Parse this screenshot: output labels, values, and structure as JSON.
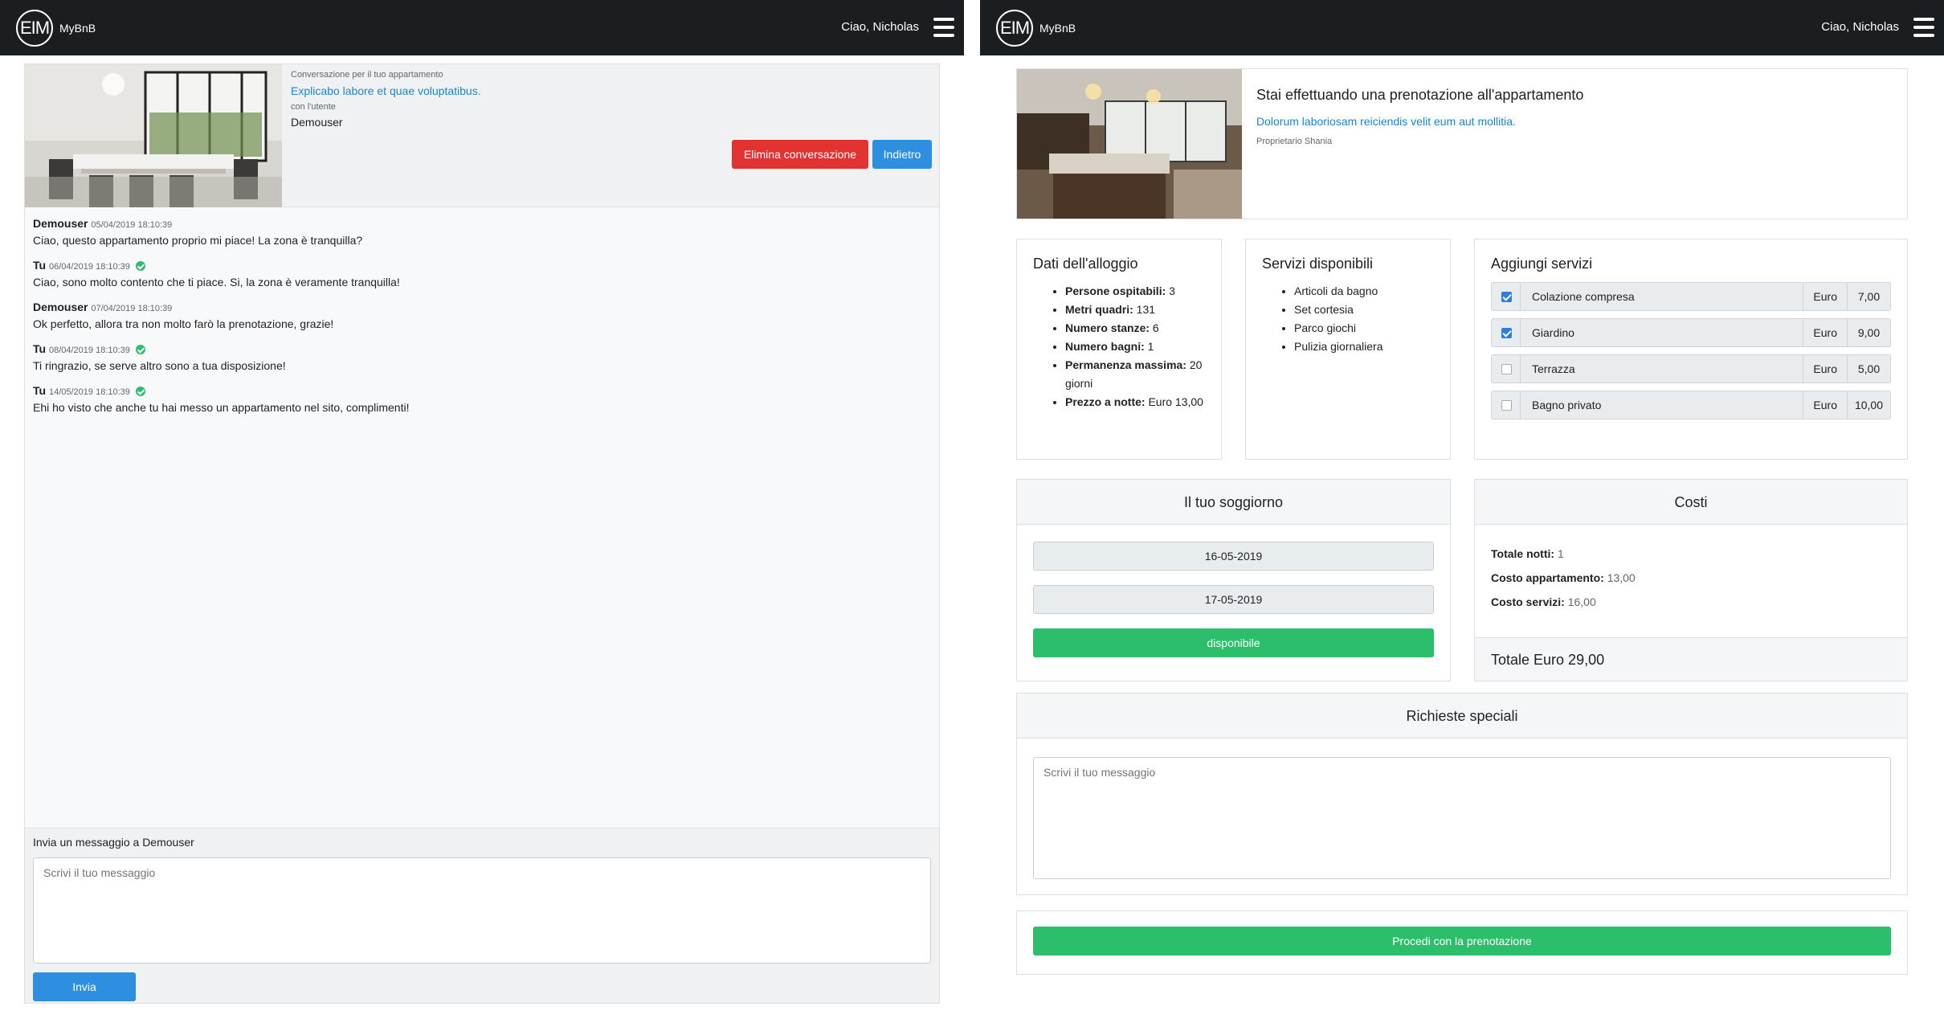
{
  "navbar": {
    "logo": "EIM",
    "brand": "MyBnB",
    "greeting": "Ciao, Nicholas"
  },
  "conversation": {
    "header_caption": "Conversazione per il tuo appartamento",
    "apartment_link": "Explicabo labore et quae voluptatibus.",
    "user_caption": "con l'utente",
    "user": "Demouser",
    "delete_button": "Elimina conversazione",
    "back_button": "Indietro",
    "messages": [
      {
        "author": "Demouser",
        "time": "05/04/2019 18:10:39",
        "text": "Ciao, questo appartamento proprio mi piace! La zona è tranquilla?",
        "mine": false
      },
      {
        "author": "Tu",
        "time": "06/04/2019 18:10:39",
        "text": "Ciao, sono molto contento che ti piace. Si, la zona è veramente tranquilla!",
        "mine": true
      },
      {
        "author": "Demouser",
        "time": "07/04/2019 18:10:39",
        "text": "Ok perfetto, allora tra non molto farò la prenotazione, grazie!",
        "mine": false
      },
      {
        "author": "Tu",
        "time": "08/04/2019 18:10:39",
        "text": "Ti ringrazio, se serve altro sono a tua disposizione!",
        "mine": true
      },
      {
        "author": "Tu",
        "time": "14/05/2019 18:10:39",
        "text": "Ehi ho visto che anche tu hai messo un appartamento nel sito, complimenti!",
        "mine": true
      }
    ],
    "compose_label": "Invia un messaggio a Demouser",
    "compose_placeholder": "Scrivi il tuo messaggio",
    "send_button": "Invia"
  },
  "booking": {
    "title": "Stai effettuando una prenotazione all'appartamento",
    "apartment_link": "Dolorum laboriosam reiciendis velit eum aut mollitia.",
    "owner": "Proprietario Shania",
    "info_title": "Dati dell'alloggio",
    "info": [
      {
        "label": "Persone ospitabili:",
        "value": "3"
      },
      {
        "label": "Metri quadri:",
        "value": "131"
      },
      {
        "label": "Numero stanze:",
        "value": "6"
      },
      {
        "label": "Numero bagni:",
        "value": "1"
      },
      {
        "label": "Permanenza massima:",
        "value": "20 giorni"
      },
      {
        "label": "Prezzo a notte:",
        "value": "Euro 13,00"
      }
    ],
    "services_title": "Servizi disponibili",
    "services": [
      "Articoli da bagno",
      "Set cortesia",
      "Parco giochi",
      "Pulizia giornaliera"
    ],
    "add_title": "Aggiungi servizi",
    "add_services": [
      {
        "name": "Colazione compresa",
        "currency": "Euro",
        "price": "7,00",
        "checked": true
      },
      {
        "name": "Giardino",
        "currency": "Euro",
        "price": "9,00",
        "checked": true
      },
      {
        "name": "Terrazza",
        "currency": "Euro",
        "price": "5,00",
        "checked": false
      },
      {
        "name": "Bagno privato",
        "currency": "Euro",
        "price": "10,00",
        "checked": false
      }
    ],
    "stay_title": "Il tuo soggiorno",
    "date_from": "16-05-2019",
    "date_to": "17-05-2019",
    "availability": "disponibile",
    "costs_title": "Costi",
    "nights_label": "Totale notti:",
    "nights_value": "1",
    "apt_cost_label": "Costo appartamento:",
    "apt_cost_value": "13,00",
    "services_cost_label": "Costo servizi:",
    "services_cost_value": "16,00",
    "total": "Totale Euro 29,00",
    "special_title": "Richieste speciali",
    "special_placeholder": "Scrivi il tuo messaggio",
    "proceed_button": "Procedi con la prenotazione"
  },
  "colors": {
    "navbar": "#1b1e21",
    "danger": "#e23232",
    "primary": "#2e8fe0",
    "success": "#2dbe6c",
    "link": "#1a86d6"
  }
}
